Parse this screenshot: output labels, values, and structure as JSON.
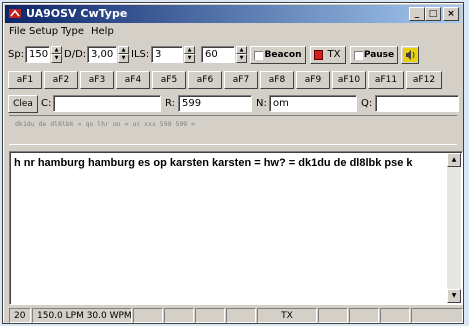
{
  "window": {
    "title": "UA9OSV CwType"
  },
  "titlebar_buttons": {
    "minimize": "_",
    "maximize": "□",
    "close": "×"
  },
  "menu": {
    "file": "File",
    "setup": "Setup",
    "type": "Type",
    "help": "Help"
  },
  "controls": {
    "sp_label": "Sp:",
    "sp_value": "150",
    "dd_label": "D/D:",
    "dd_value": "3,00",
    "ils_label": "ILS:",
    "ils_value": "3",
    "third_value": "60",
    "beacon_label": "Beacon",
    "tx_label": "TX",
    "pause_label": "Pause"
  },
  "fkeys": [
    "aF1",
    "aF2",
    "aF3",
    "aF4",
    "aF5",
    "aF6",
    "aF7",
    "aF8",
    "aF9",
    "aF10",
    "aF11",
    "aF12"
  ],
  "qso": {
    "clear_label": "Clea",
    "call_label": "C:",
    "call_value": "",
    "rst_label": "R:",
    "rst_value": "599",
    "name_label": "N:",
    "name_value": "om",
    "qth_label": "Q:",
    "qth_value": ""
  },
  "send_text": "dk1du de dl8lbk = qo lhr on = uc xxx 599 599 =",
  "receive_text": "h nr hamburg hamburg es op karsten karsten = hw? = dk1du de dl8lbk pse k",
  "status": {
    "count": "20",
    "speed": "150.0 LPM  30.0 WPM",
    "mode": "TX"
  },
  "colors": {
    "title_start": "#0a246a",
    "title_end": "#a6caf0",
    "tx_red": "#d02020",
    "speaker_yellow": "#e8d010"
  }
}
